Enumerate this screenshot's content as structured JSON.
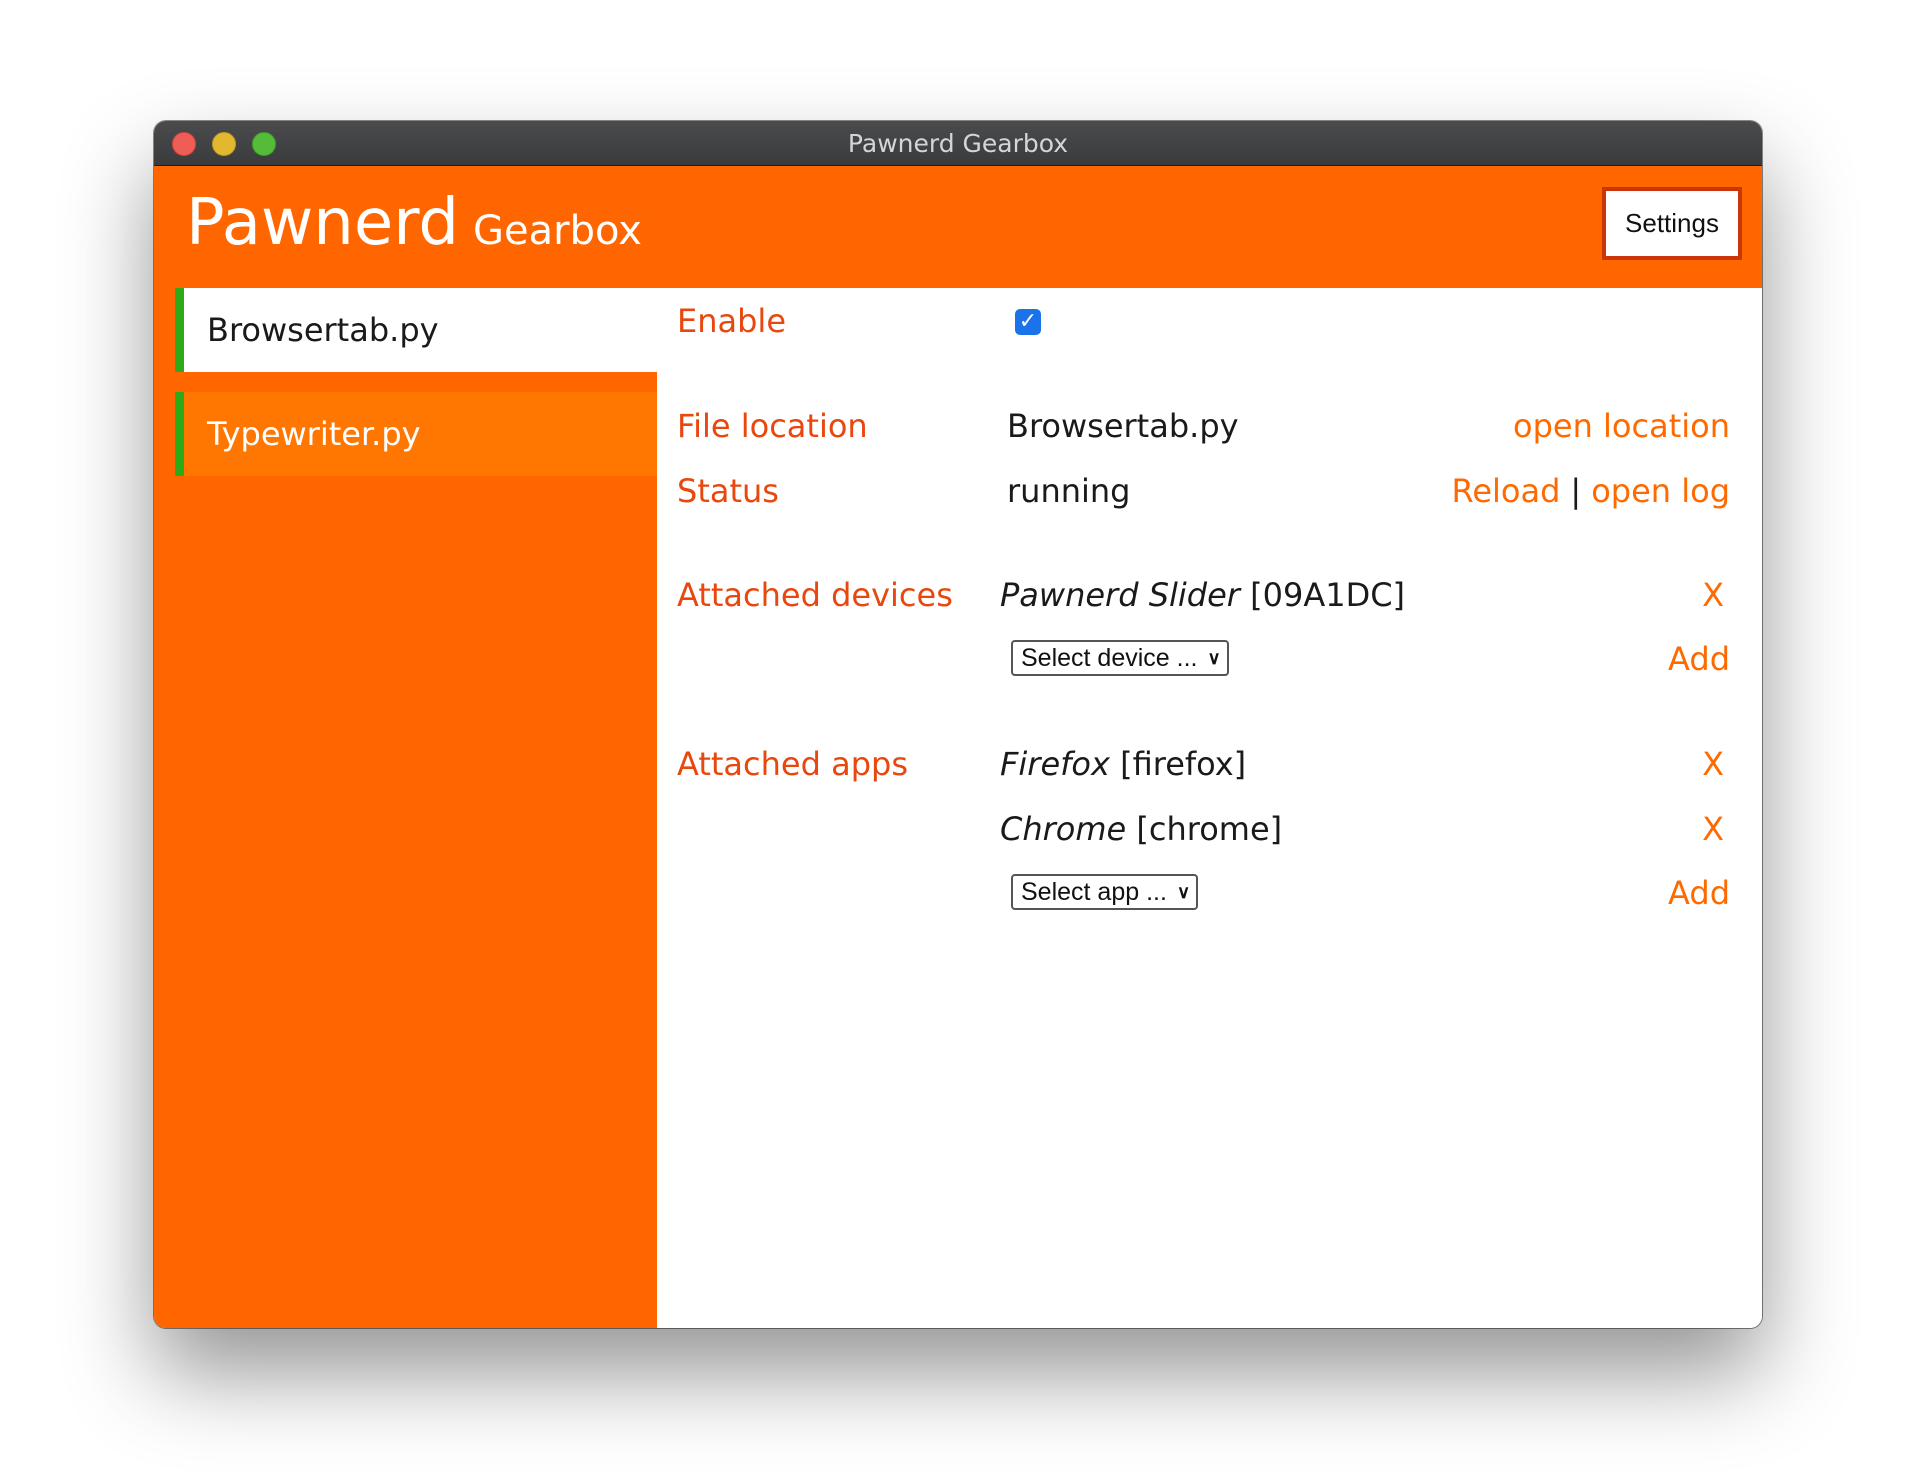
{
  "window": {
    "title": "Pawnerd Gearbox"
  },
  "header": {
    "brand_main": "Pawnerd",
    "brand_sub": "Gearbox",
    "settings_label": "Settings"
  },
  "sidebar": {
    "items": [
      {
        "label": "Browsertab.py",
        "active": true
      },
      {
        "label": "Typewriter.py",
        "active": false
      }
    ]
  },
  "details": {
    "enable": {
      "label": "Enable",
      "checked": true
    },
    "file_location": {
      "label": "File location",
      "value": "Browsertab.py",
      "action": "open location"
    },
    "status": {
      "label": "Status",
      "value": "running",
      "reload": "Reload",
      "separator": "|",
      "open_log": "open log"
    },
    "devices": {
      "label": "Attached devices",
      "items": [
        {
          "name": "Pawnerd Slider",
          "id": "[09A1DC]",
          "remove": "X"
        }
      ],
      "select_placeholder": "Select device ...",
      "add_label": "Add"
    },
    "apps": {
      "label": "Attached apps",
      "items": [
        {
          "name": "Firefox",
          "id": "[firefox]",
          "remove": "X"
        },
        {
          "name": "Chrome",
          "id": "[chrome]",
          "remove": "X"
        }
      ],
      "select_placeholder": "Select app ...",
      "add_label": "Add"
    }
  },
  "colors": {
    "accent": "#ff6600",
    "accent_light": "#ff7700",
    "label_text": "#e8470e",
    "active_indicator": "#2eaa18",
    "checkbox": "#1a73e8"
  }
}
